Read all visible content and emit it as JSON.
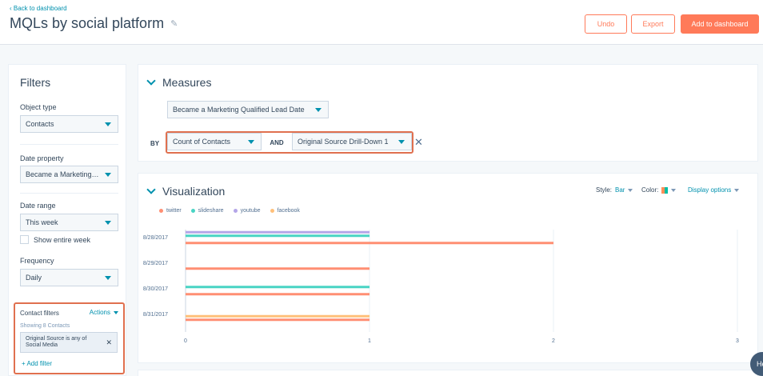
{
  "header": {
    "back_link": "Back to dashboard",
    "title": "MQLs by social platform",
    "undo": "Undo",
    "export": "Export",
    "add": "Add to dashboard"
  },
  "filters": {
    "title": "Filters",
    "object_type_label": "Object type",
    "object_type_value": "Contacts",
    "date_property_label": "Date property",
    "date_property_value": "Became a Marketing…",
    "date_range_label": "Date range",
    "date_range_value": "This week",
    "show_entire_week": "Show entire week",
    "frequency_label": "Frequency",
    "frequency_value": "Daily",
    "contact_filters": {
      "title": "Contact filters",
      "actions": "Actions",
      "showing": "Showing 8 Contacts",
      "chip": "Original Source is any of Social Media",
      "add_filter": "+ Add filter"
    }
  },
  "measures": {
    "title": "Measures",
    "date_select": "Became a Marketing Qualified Lead Date",
    "by": "BY",
    "count_select": "Count of Contacts",
    "and": "AND",
    "drilldown_select": "Original Source Drill-Down 1"
  },
  "visualization": {
    "title": "Visualization",
    "style_label": "Style:",
    "style_value": "Bar",
    "color_label": "Color:",
    "display_options": "Display options"
  },
  "help": "He",
  "chart_data": {
    "type": "bar",
    "orientation": "horizontal",
    "categories": [
      "8/28/2017",
      "8/29/2017",
      "8/30/2017",
      "8/31/2017"
    ],
    "series": [
      {
        "name": "twitter",
        "color": "#ff8f73",
        "values": [
          2,
          1,
          1,
          1
        ]
      },
      {
        "name": "slideshare",
        "color": "#49d4c4",
        "values": [
          1,
          0,
          1,
          0
        ]
      },
      {
        "name": "youtube",
        "color": "#b4a6e8",
        "values": [
          1,
          0,
          0,
          0
        ]
      },
      {
        "name": "facebook",
        "color": "#ffc07a",
        "values": [
          0,
          0,
          0,
          1
        ]
      }
    ],
    "xticks": [
      "0",
      "1",
      "2",
      "3"
    ],
    "xlim": [
      0,
      3
    ],
    "grid": true,
    "legend": "top-left"
  }
}
